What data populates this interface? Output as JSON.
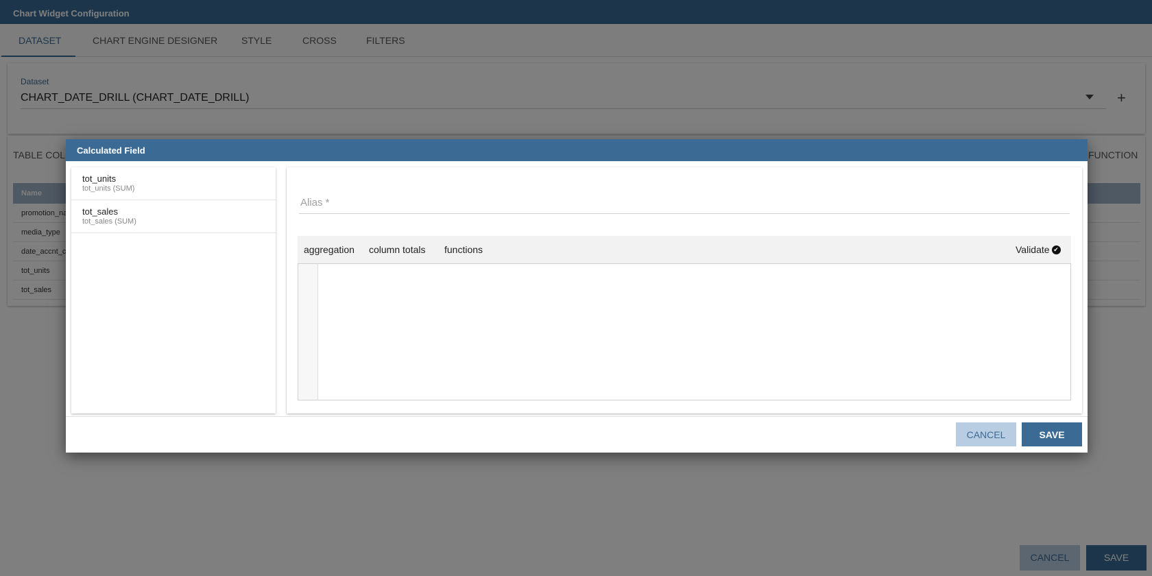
{
  "app": {
    "title": "Chart Widget Configuration"
  },
  "tabs": [
    {
      "label": "DATASET",
      "active": true
    },
    {
      "label": "CHART ENGINE DESIGNER",
      "active": false
    },
    {
      "label": "STYLE",
      "active": false
    },
    {
      "label": "CROSS",
      "active": false
    },
    {
      "label": "FILTERS",
      "active": false
    }
  ],
  "dataset": {
    "label": "Dataset",
    "value": "CHART_DATE_DRILL (CHART_DATE_DRILL)",
    "add_icon": "plus-icon",
    "dropdown_icon": "caret-down-icon"
  },
  "columns": {
    "title": "TABLE COLU",
    "right_button": "FUNCTION",
    "header": "Name",
    "rows": [
      "promotion_na",
      "media_type",
      "date_accnt_c",
      "tot_units",
      "tot_sales"
    ]
  },
  "bottom_buttons": {
    "cancel": "CANCEL",
    "save": "SAVE"
  },
  "dialog": {
    "title": "Calculated Field",
    "fields": [
      {
        "name": "tot_units",
        "aggregation": "tot_units (SUM)"
      },
      {
        "name": "tot_sales",
        "aggregation": "tot_sales (SUM)"
      }
    ],
    "alias_placeholder": "Alias *",
    "alias_value": "",
    "toolbar": {
      "aggregation": "aggregation",
      "column_totals": "column totals",
      "functions": "functions",
      "validate": "Validate",
      "validate_icon": "check-circle-icon"
    },
    "cancel_label": "CANCEL",
    "save_label": "SAVE"
  },
  "colors": {
    "primary": "#3b6a94",
    "cancel_bg": "#b9cde2",
    "overlay": "rgba(0,0,0,0.5)"
  }
}
